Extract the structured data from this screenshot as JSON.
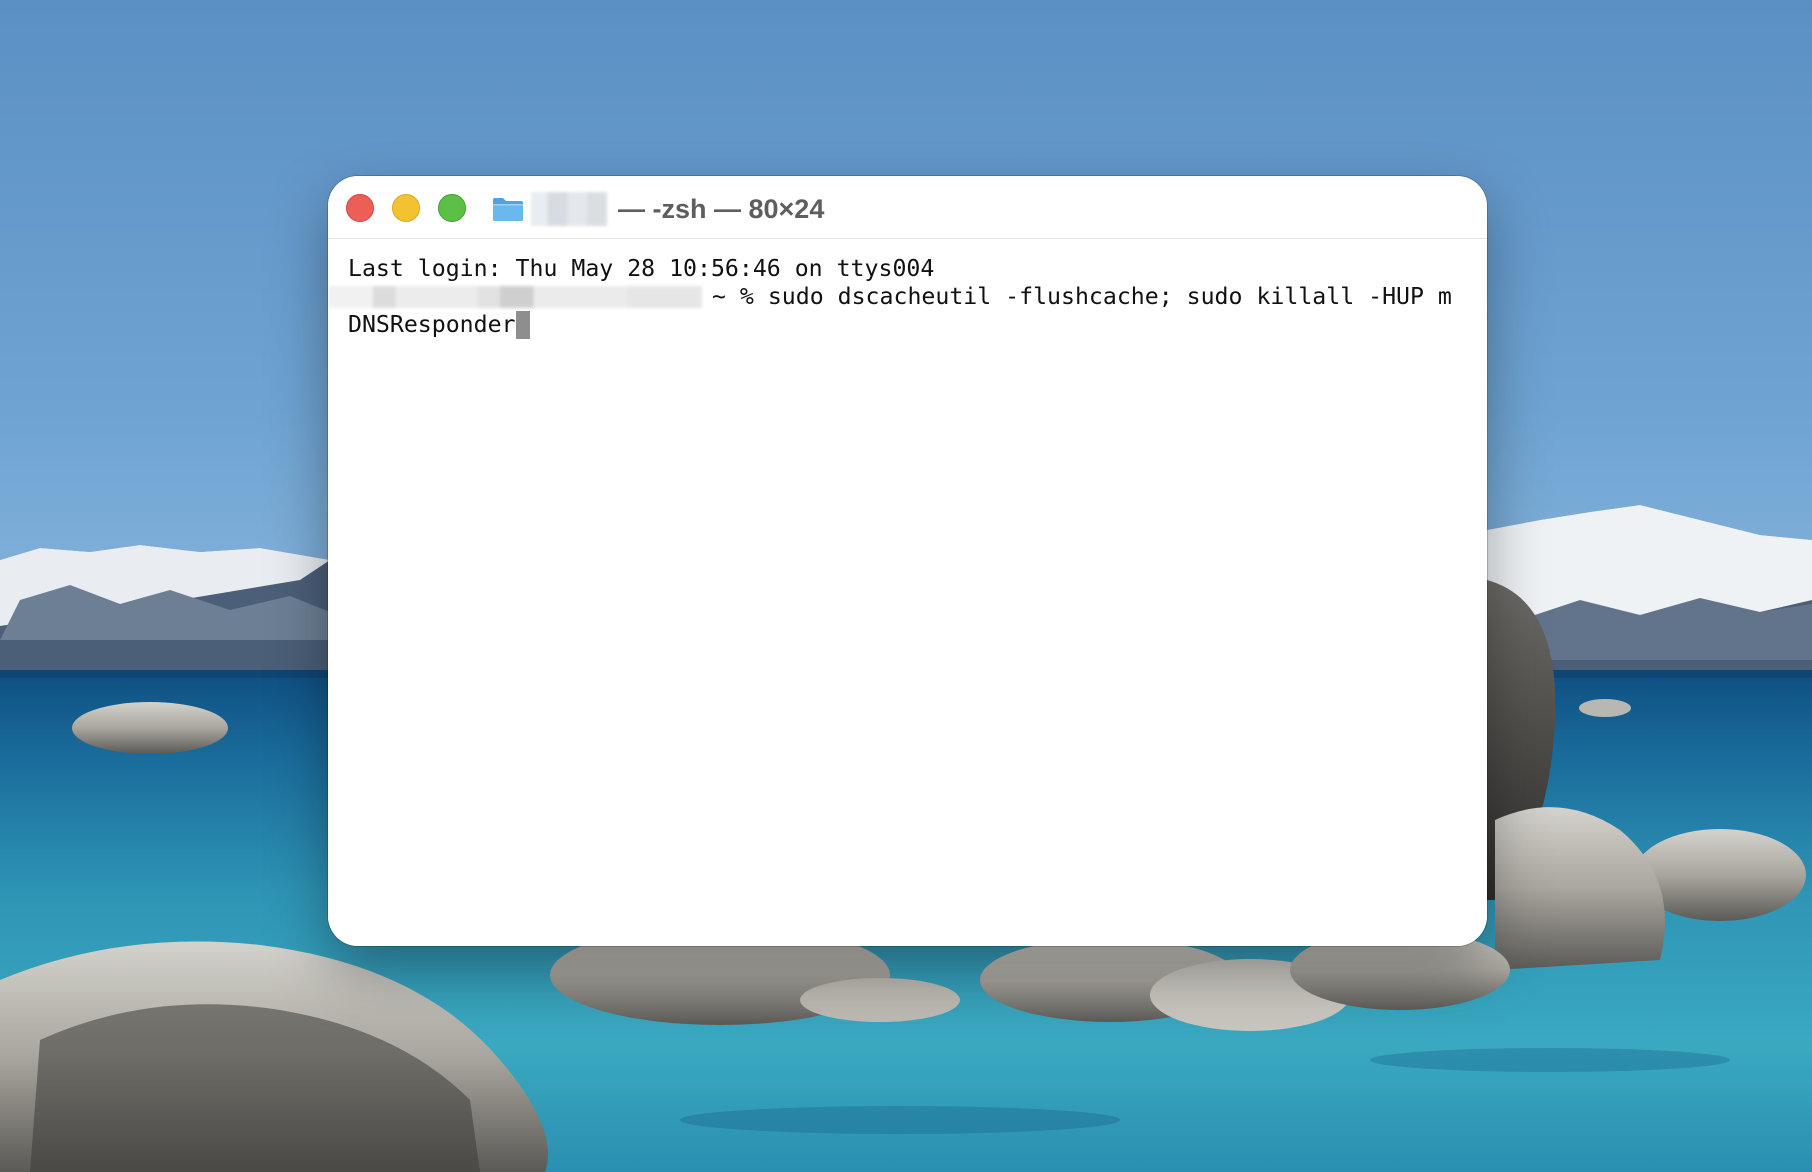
{
  "window": {
    "title": "— -zsh — 80×24",
    "title_redacted": true,
    "controls": {
      "close_color": "#ec5f57",
      "minimize_color": "#f2c231",
      "zoom_color": "#5cc046"
    },
    "icon": "folder-icon"
  },
  "terminal": {
    "lines": [
      "Last login: Thu May 28 10:56:46 on ttys004",
      "~ % sudo dscacheutil -flushcache; sudo killall -HUP m",
      "DNSResponder"
    ],
    "prompt_redacted": true,
    "cursor_visible": true
  },
  "desktop": {
    "wallpaper": "lake-with-mountains-and-boulders"
  }
}
